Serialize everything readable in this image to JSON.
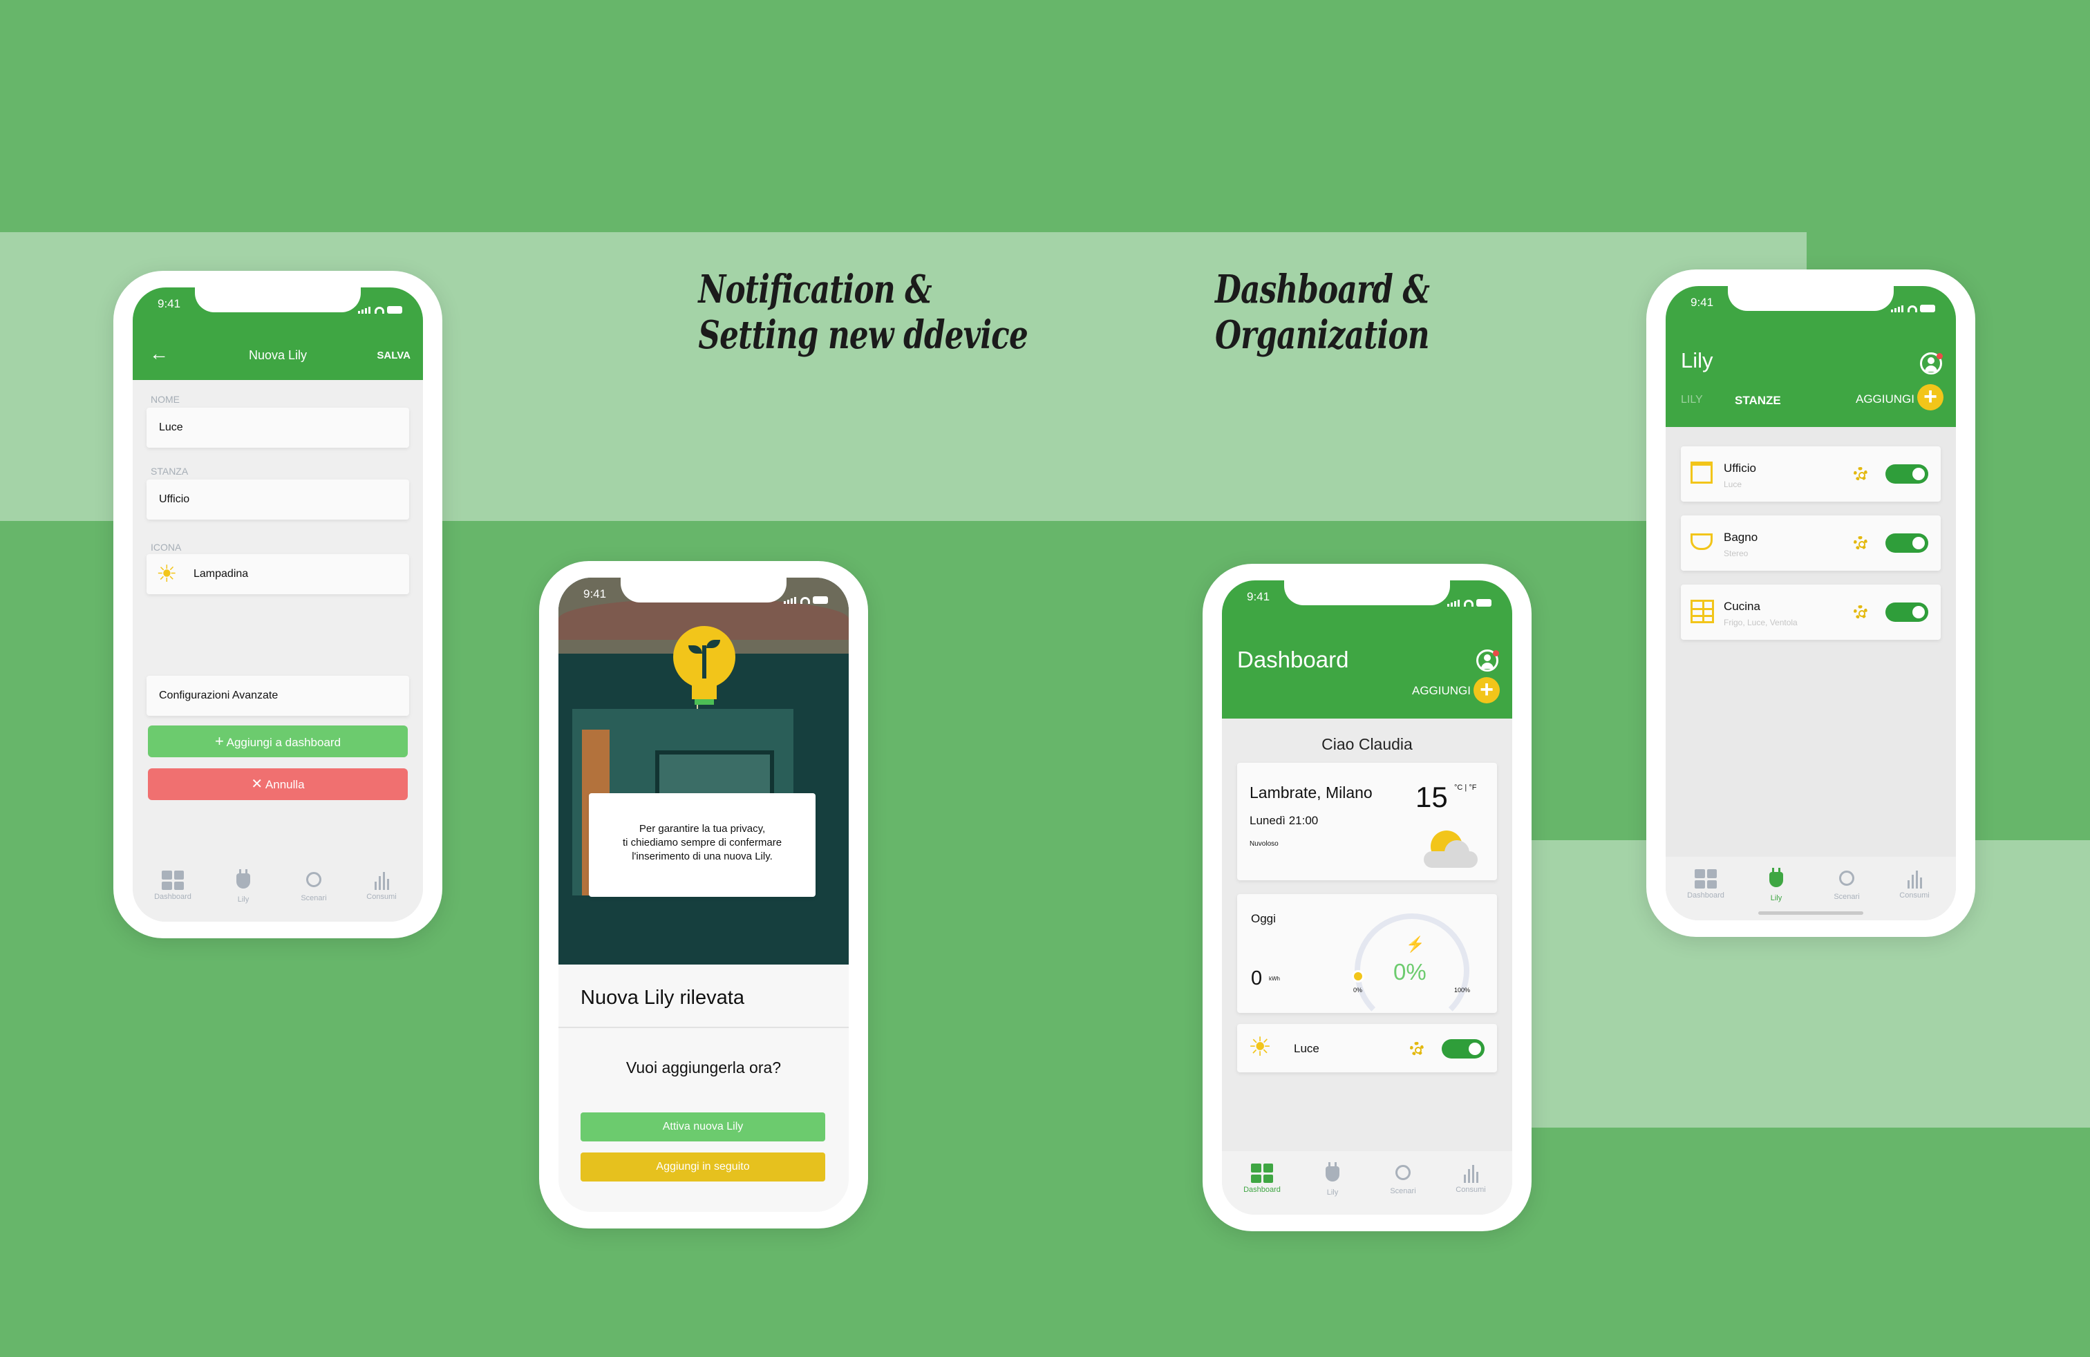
{
  "headings": {
    "notification": [
      "Notification &",
      "Setting new ddevice"
    ],
    "dashboard": [
      "Dashboard &",
      "Organization"
    ]
  },
  "status_time": "9:41",
  "tabs": [
    "Dashboard",
    "Lily",
    "Scenari",
    "Consumi"
  ],
  "phone1": {
    "title": "Nuova Lily",
    "save_label": "SALVA",
    "nome_label": "NOME",
    "nome_value": "Luce",
    "stanza_label": "STANZA",
    "stanza_value": "Ufficio",
    "icona_label": "ICONA",
    "icona_value": "Lampadina",
    "advanced_label": "Configurazioni Avanzate",
    "add_button": "Aggiungi a dashboard",
    "cancel_button": "Annulla"
  },
  "phone2": {
    "privacy_text_1": "Per garantire la tua privacy,",
    "privacy_text_2": "ti chiediamo sempre di confermare",
    "privacy_text_3": "l'inserimento di una nuova Lily.",
    "detected_title": "Nuova Lily rilevata",
    "question": "Vuoi aggiungerla ora?",
    "activate_button": "Attiva nuova Lily",
    "later_button": "Aggiungi in seguito"
  },
  "phone3": {
    "title": "Dashboard",
    "add_label": "AGGIUNGI",
    "greeting": "Ciao Claudia",
    "weather": {
      "location": "Lambrate, Milano",
      "temperature": "15",
      "units": "°C | °F",
      "datetime": "Lunedì 21:00",
      "condition": "Nuvoloso"
    },
    "today": {
      "label": "Oggi",
      "kwh_value": "0",
      "kwh_unit": "kWh",
      "percent": "0%",
      "min_label": "0%",
      "max_label": "100%",
      "level": 0
    },
    "device": {
      "name": "Luce",
      "on": true
    }
  },
  "phone4": {
    "title": "Lily",
    "tab_lily": "LILY",
    "tab_stanze": "STANZE",
    "add_label": "AGGIUNGI",
    "rooms": [
      {
        "name": "Ufficio",
        "sub": "Luce",
        "icon": "desk-icon",
        "on": true
      },
      {
        "name": "Bagno",
        "sub": "Stereo",
        "icon": "bathtub-icon",
        "on": true
      },
      {
        "name": "Cucina",
        "sub": "Frigo, Luce, Ventola",
        "icon": "kitchen-icon",
        "on": true
      }
    ]
  },
  "colors": {
    "background": "#67b66a",
    "band": "#a4d3a7",
    "app_green": "#3fa643",
    "accent_yellow": "#f2c51a",
    "cancel_red": "#f07070",
    "toggle_green": "#2f9e3a"
  }
}
